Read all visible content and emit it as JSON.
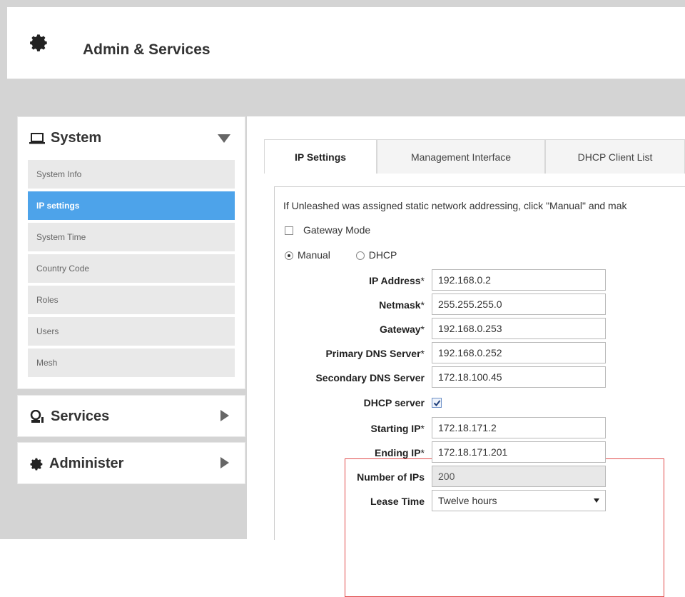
{
  "header": {
    "title": "Admin & Services",
    "icon": "gear-icon"
  },
  "sidebar": {
    "system": {
      "label": "System",
      "icon": "laptop-icon",
      "items": [
        {
          "label": "System Info",
          "active": false
        },
        {
          "label": "IP settings",
          "active": true
        },
        {
          "label": "System Time",
          "active": false
        },
        {
          "label": "Country Code",
          "active": false
        },
        {
          "label": "Roles",
          "active": false
        },
        {
          "label": "Users",
          "active": false
        },
        {
          "label": "Mesh",
          "active": false
        }
      ]
    },
    "services": {
      "label": "Services",
      "icon": "services-icon"
    },
    "administer": {
      "label": "Administer",
      "icon": "gear-icon"
    }
  },
  "tabs": [
    {
      "label": "IP Settings",
      "active": true
    },
    {
      "label": "Management Interface",
      "active": false
    },
    {
      "label": "DHCP Client List",
      "active": false
    }
  ],
  "form": {
    "intro": "If Unleashed was assigned static network addressing, click \"Manual\" and mak",
    "gateway_mode": {
      "label": "Gateway Mode",
      "checked": false
    },
    "mode": {
      "manual": "Manual",
      "dhcp": "DHCP",
      "selected": "Manual"
    },
    "ip_address": {
      "label": "IP Address",
      "value": "192.168.0.2"
    },
    "netmask": {
      "label": "Netmask",
      "value": "255.255.255.0"
    },
    "gateway": {
      "label": "Gateway",
      "value": "192.168.0.253"
    },
    "primary_dns": {
      "label": "Primary DNS Server",
      "value": "192.168.0.252"
    },
    "secondary_dns": {
      "label": "Secondary DNS Server",
      "value": "172.18.100.45"
    },
    "dhcp_server": {
      "label": "DHCP server",
      "checked": true
    },
    "starting_ip": {
      "label": "Starting IP",
      "value": "172.18.171.2"
    },
    "ending_ip": {
      "label": "Ending IP",
      "value": "172.18.171.201"
    },
    "number_of_ips": {
      "label": "Number of IPs",
      "value": "200"
    },
    "lease_time": {
      "label": "Lease Time",
      "value": "Twelve hours"
    },
    "required_mark": "*"
  },
  "colors": {
    "accent": "#4da3ea",
    "highlight_border": "#e04a4a"
  }
}
